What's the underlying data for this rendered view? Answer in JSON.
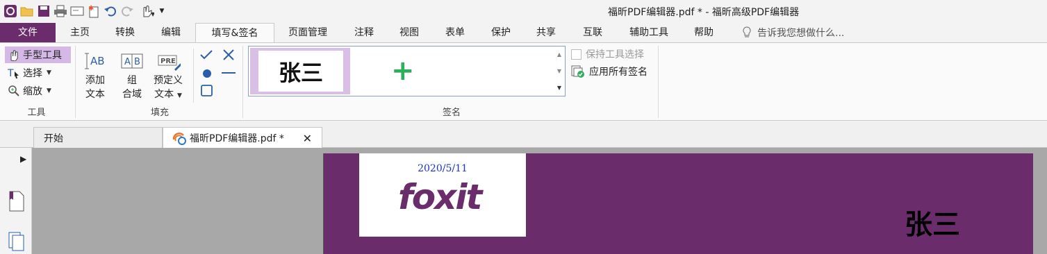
{
  "window_title": "福昕PDF编辑器.pdf * - 福昕高级PDF编辑器",
  "tabs": {
    "file": "文件",
    "items": [
      "主页",
      "转换",
      "编辑",
      "填写&签名",
      "页面管理",
      "注释",
      "视图",
      "表单",
      "保护",
      "共享",
      "互联",
      "辅助工具",
      "帮助"
    ],
    "active": "填写&签名",
    "tell_me": "告诉我您想做什么..."
  },
  "ribbon": {
    "tools_group": {
      "label": "工具",
      "hand": "手型工具",
      "select": "选择",
      "zoom": "缩放"
    },
    "fill_group": {
      "label": "填充",
      "add_text": [
        "添加",
        "文本"
      ],
      "comb_field": [
        "组",
        "合域"
      ],
      "predefined_text": [
        "预定义",
        "文本"
      ]
    },
    "sign_group": {
      "label": "签名",
      "signature_name": "张三",
      "keep_tool_selected": "保持工具选择",
      "apply_all_signatures": "应用所有签名"
    }
  },
  "doc_tabs": {
    "start": "开始",
    "file": "福昕PDF编辑器.pdf *"
  },
  "document": {
    "stamp_date": "2020/5/11",
    "logo_text": "foxit",
    "signature": "张三"
  },
  "colors": {
    "brand_purple": "#6b2c6c",
    "highlight": "#d6b8e6",
    "add_green": "#2fae5b",
    "date_blue": "#1a2fd6"
  }
}
